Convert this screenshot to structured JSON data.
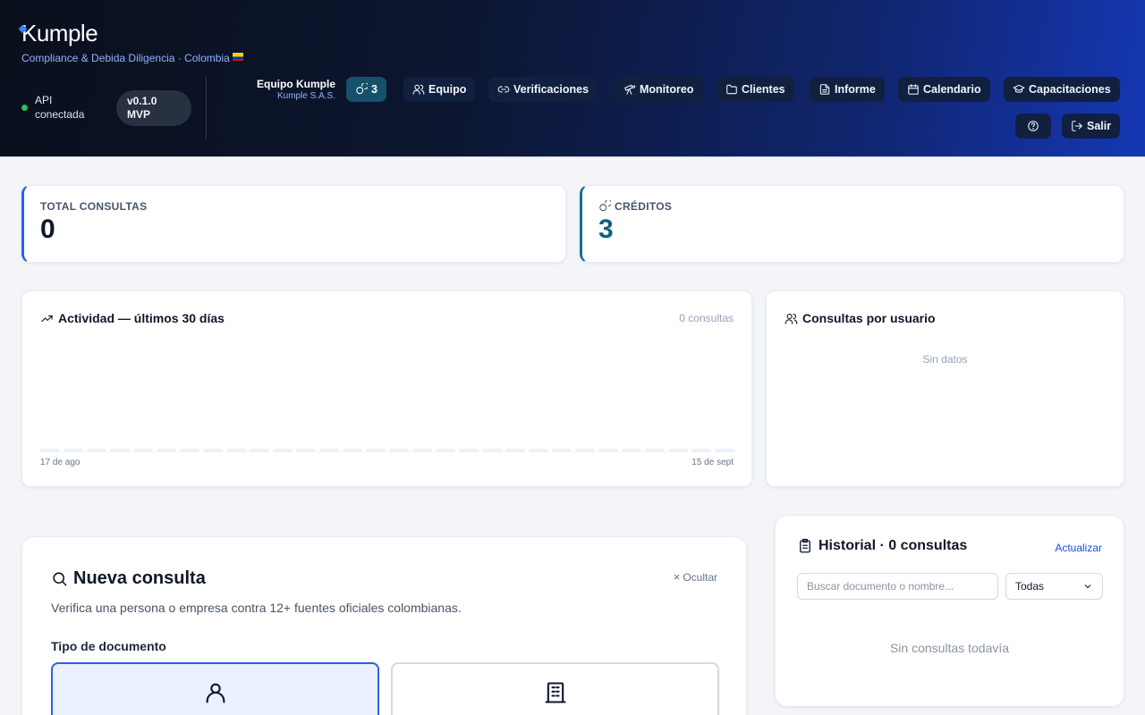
{
  "brand": {
    "logo": "Kumple",
    "tagline": "Compliance & Debida Diligencia · Colombia"
  },
  "status": {
    "api_label": "API conectada",
    "version": "v0.1.0 MVP",
    "dot_color": "#22c55e"
  },
  "team": {
    "name": "Equipo Kumple",
    "org": "Kumple S.A.S."
  },
  "nav": {
    "credits": "3",
    "items": [
      "Equipo",
      "Verificaciones",
      "Monitoreo",
      "Clientes",
      "Informe",
      "Calendario",
      "Capacitaciones"
    ],
    "logout": "Salir",
    "help_icon": "help-icon"
  },
  "stats": {
    "total_label": "TOTAL CONSULTAS",
    "total_value": "0",
    "credits_label": "CRÉDITOS",
    "credits_value": "3",
    "accent_total": "#2563eb",
    "accent_credits": "#0e7490"
  },
  "activity": {
    "title": "Actividad — últimos 30 días",
    "count": "0 consultas",
    "start_date": "17 de ago",
    "end_date": "15 de sept"
  },
  "per_user": {
    "title": "Consultas por usuario",
    "empty": "Sin datos"
  },
  "new_query": {
    "title": "Nueva consulta",
    "hide": "Ocultar",
    "description": "Verifica una persona o empresa contra 12+ fuentes oficiales colombianas.",
    "doc_type_label": "Tipo de documento",
    "doc_types": [
      "person",
      "company"
    ],
    "selected": "person"
  },
  "history": {
    "title": "Historial · 0 consultas",
    "refresh": "Actualizar",
    "search_placeholder": "Buscar documento o nombre...",
    "filter_value": "Todas",
    "empty": "Sin consultas todavía"
  }
}
